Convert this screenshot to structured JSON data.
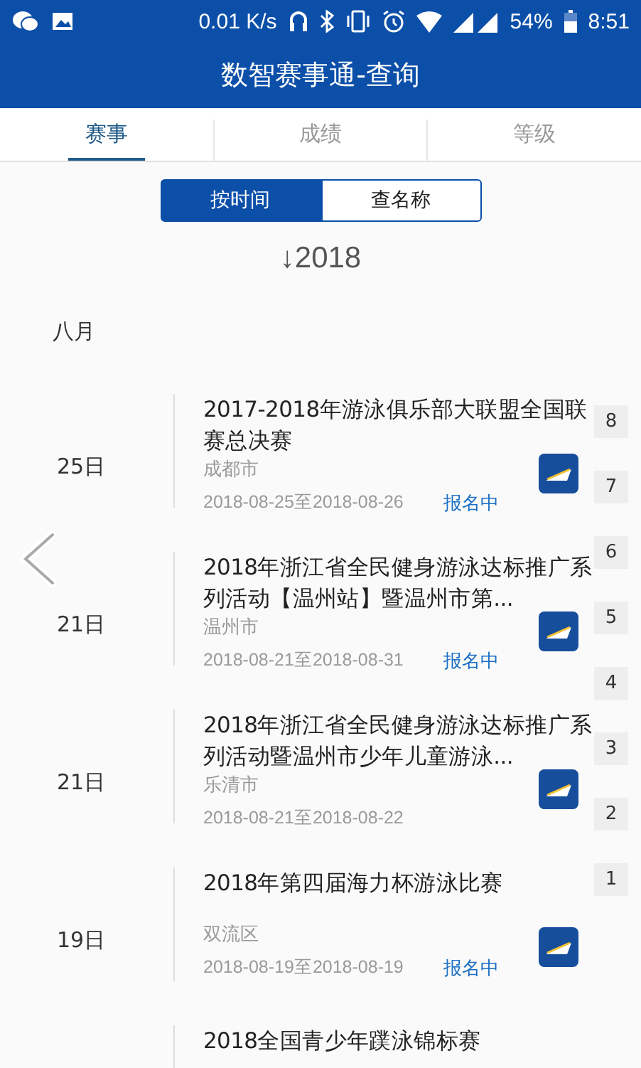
{
  "status_bar": {
    "speed": "0.01 K/s",
    "battery": "54%",
    "time": "8:51"
  },
  "header": {
    "title": "数智赛事通-查询"
  },
  "tabs": [
    {
      "label": "赛事",
      "selected": true
    },
    {
      "label": "成绩",
      "selected": false
    },
    {
      "label": "等级",
      "selected": false
    }
  ],
  "segments": [
    {
      "label": "按时间",
      "selected": true
    },
    {
      "label": "查名称",
      "selected": false
    }
  ],
  "year": "↓2018",
  "month": "八月",
  "events": [
    {
      "day": "25日",
      "title": "2017-2018年游泳俱乐部大联盟全国联赛总决赛",
      "location": "成都市",
      "dates": "2018-08-25至2018-08-26",
      "status": "报名中"
    },
    {
      "day": "21日",
      "title": "2018年浙江省全民健身游泳达标推广系列活动【温州站】暨温州市第...",
      "location": "温州市",
      "dates": "2018-08-21至2018-08-31",
      "status": "报名中"
    },
    {
      "day": "21日",
      "title": "2018年浙江省全民健身游泳达标推广系列活动暨温州市少年儿童游泳...",
      "location": "乐清市",
      "dates": "2018-08-21至2018-08-22"
    },
    {
      "day": "19日",
      "title": "2018年第四届海力杯游泳比赛",
      "location": "双流区",
      "dates": "2018-08-19至2018-08-19",
      "status": "报名中"
    },
    {
      "title": "2018全国青少年蹼泳锦标赛"
    }
  ],
  "index": [
    "8",
    "7",
    "6",
    "5",
    "4",
    "3",
    "2",
    "1"
  ]
}
